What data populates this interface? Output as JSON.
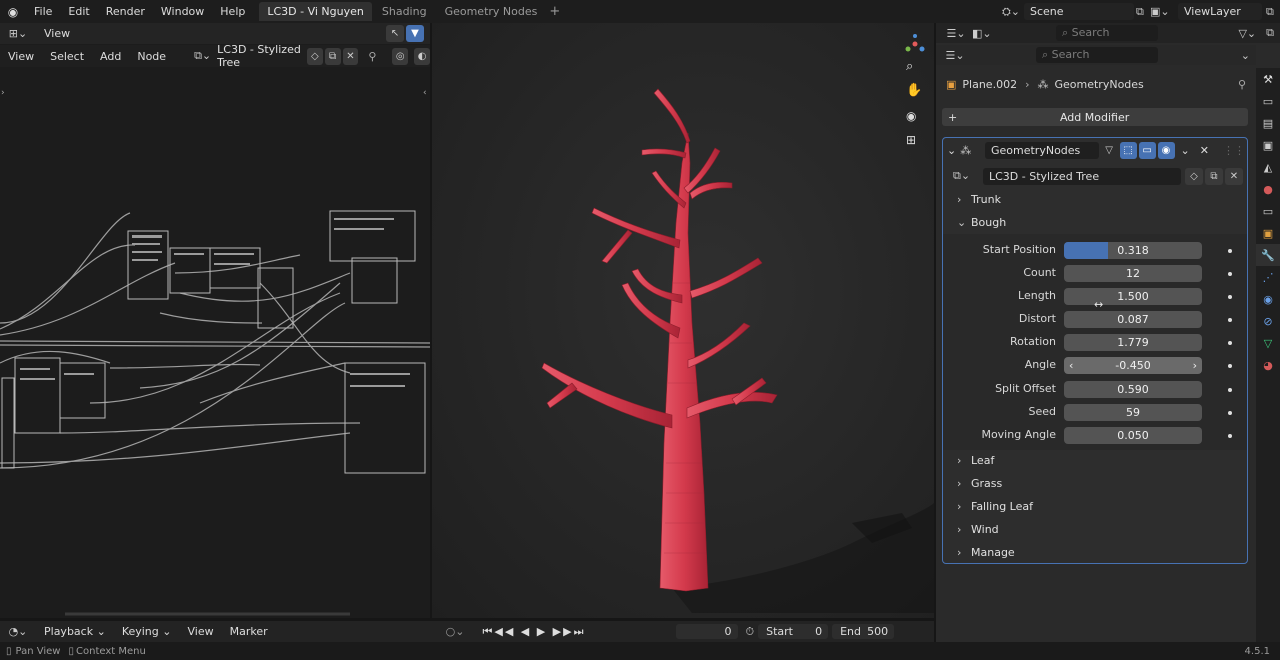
{
  "topbar": {
    "menus": [
      "File",
      "Edit",
      "Render",
      "Window",
      "Help"
    ],
    "workspaces": [
      "LC3D - Vi Nguyen",
      "Shading",
      "Geometry Nodes"
    ],
    "active_workspace": "LC3D - Vi Nguyen",
    "add_tab": "+",
    "scene": "Scene",
    "view_layer": "ViewLayer"
  },
  "node_editor": {
    "view_menu": "View",
    "menus": [
      "View",
      "Select",
      "Add",
      "Node"
    ],
    "node_tree": "LC3D - Stylized Tree"
  },
  "properties": {
    "search_placeholder": "Search",
    "search_placeholder_2": "Search",
    "breadcrumb_object": "Plane.002",
    "breadcrumb_modifier": "GeometryNodes",
    "add_modifier": "Add Modifier",
    "modifier_name": "GeometryNodes",
    "node_group": "LC3D - Stylized Tree",
    "sections_top": [
      "Trunk",
      "Bough"
    ],
    "bough_fields": [
      {
        "label": "Start Position",
        "value": "0.318",
        "fill": 0.318
      },
      {
        "label": "Count",
        "value": "12"
      },
      {
        "label": "Length",
        "value": "1.500"
      },
      {
        "label": "Distort",
        "value": "0.087"
      },
      {
        "label": "Rotation",
        "value": "1.779"
      },
      {
        "label": "Angle",
        "value": "-0.450"
      },
      {
        "label": "Split Offset",
        "value": "0.590"
      },
      {
        "label": "Seed",
        "value": "59"
      },
      {
        "label": "Moving Angle",
        "value": "0.050"
      }
    ],
    "sections_bottom": [
      "Leaf",
      "Grass",
      "Falling Leaf",
      "Wind",
      "Manage"
    ]
  },
  "timeline": {
    "menus": [
      "Playback",
      "Keying",
      "View",
      "Marker"
    ],
    "current_frame": "0",
    "start_label": "Start",
    "start_value": "0",
    "end_label": "End",
    "end_value": "500"
  },
  "statusbar": {
    "pan_view": "Pan View",
    "context_menu": "Context Menu",
    "version": "4.5.1"
  },
  "colors": {
    "accent": "#4772b3",
    "tree": "#e04a5a"
  }
}
